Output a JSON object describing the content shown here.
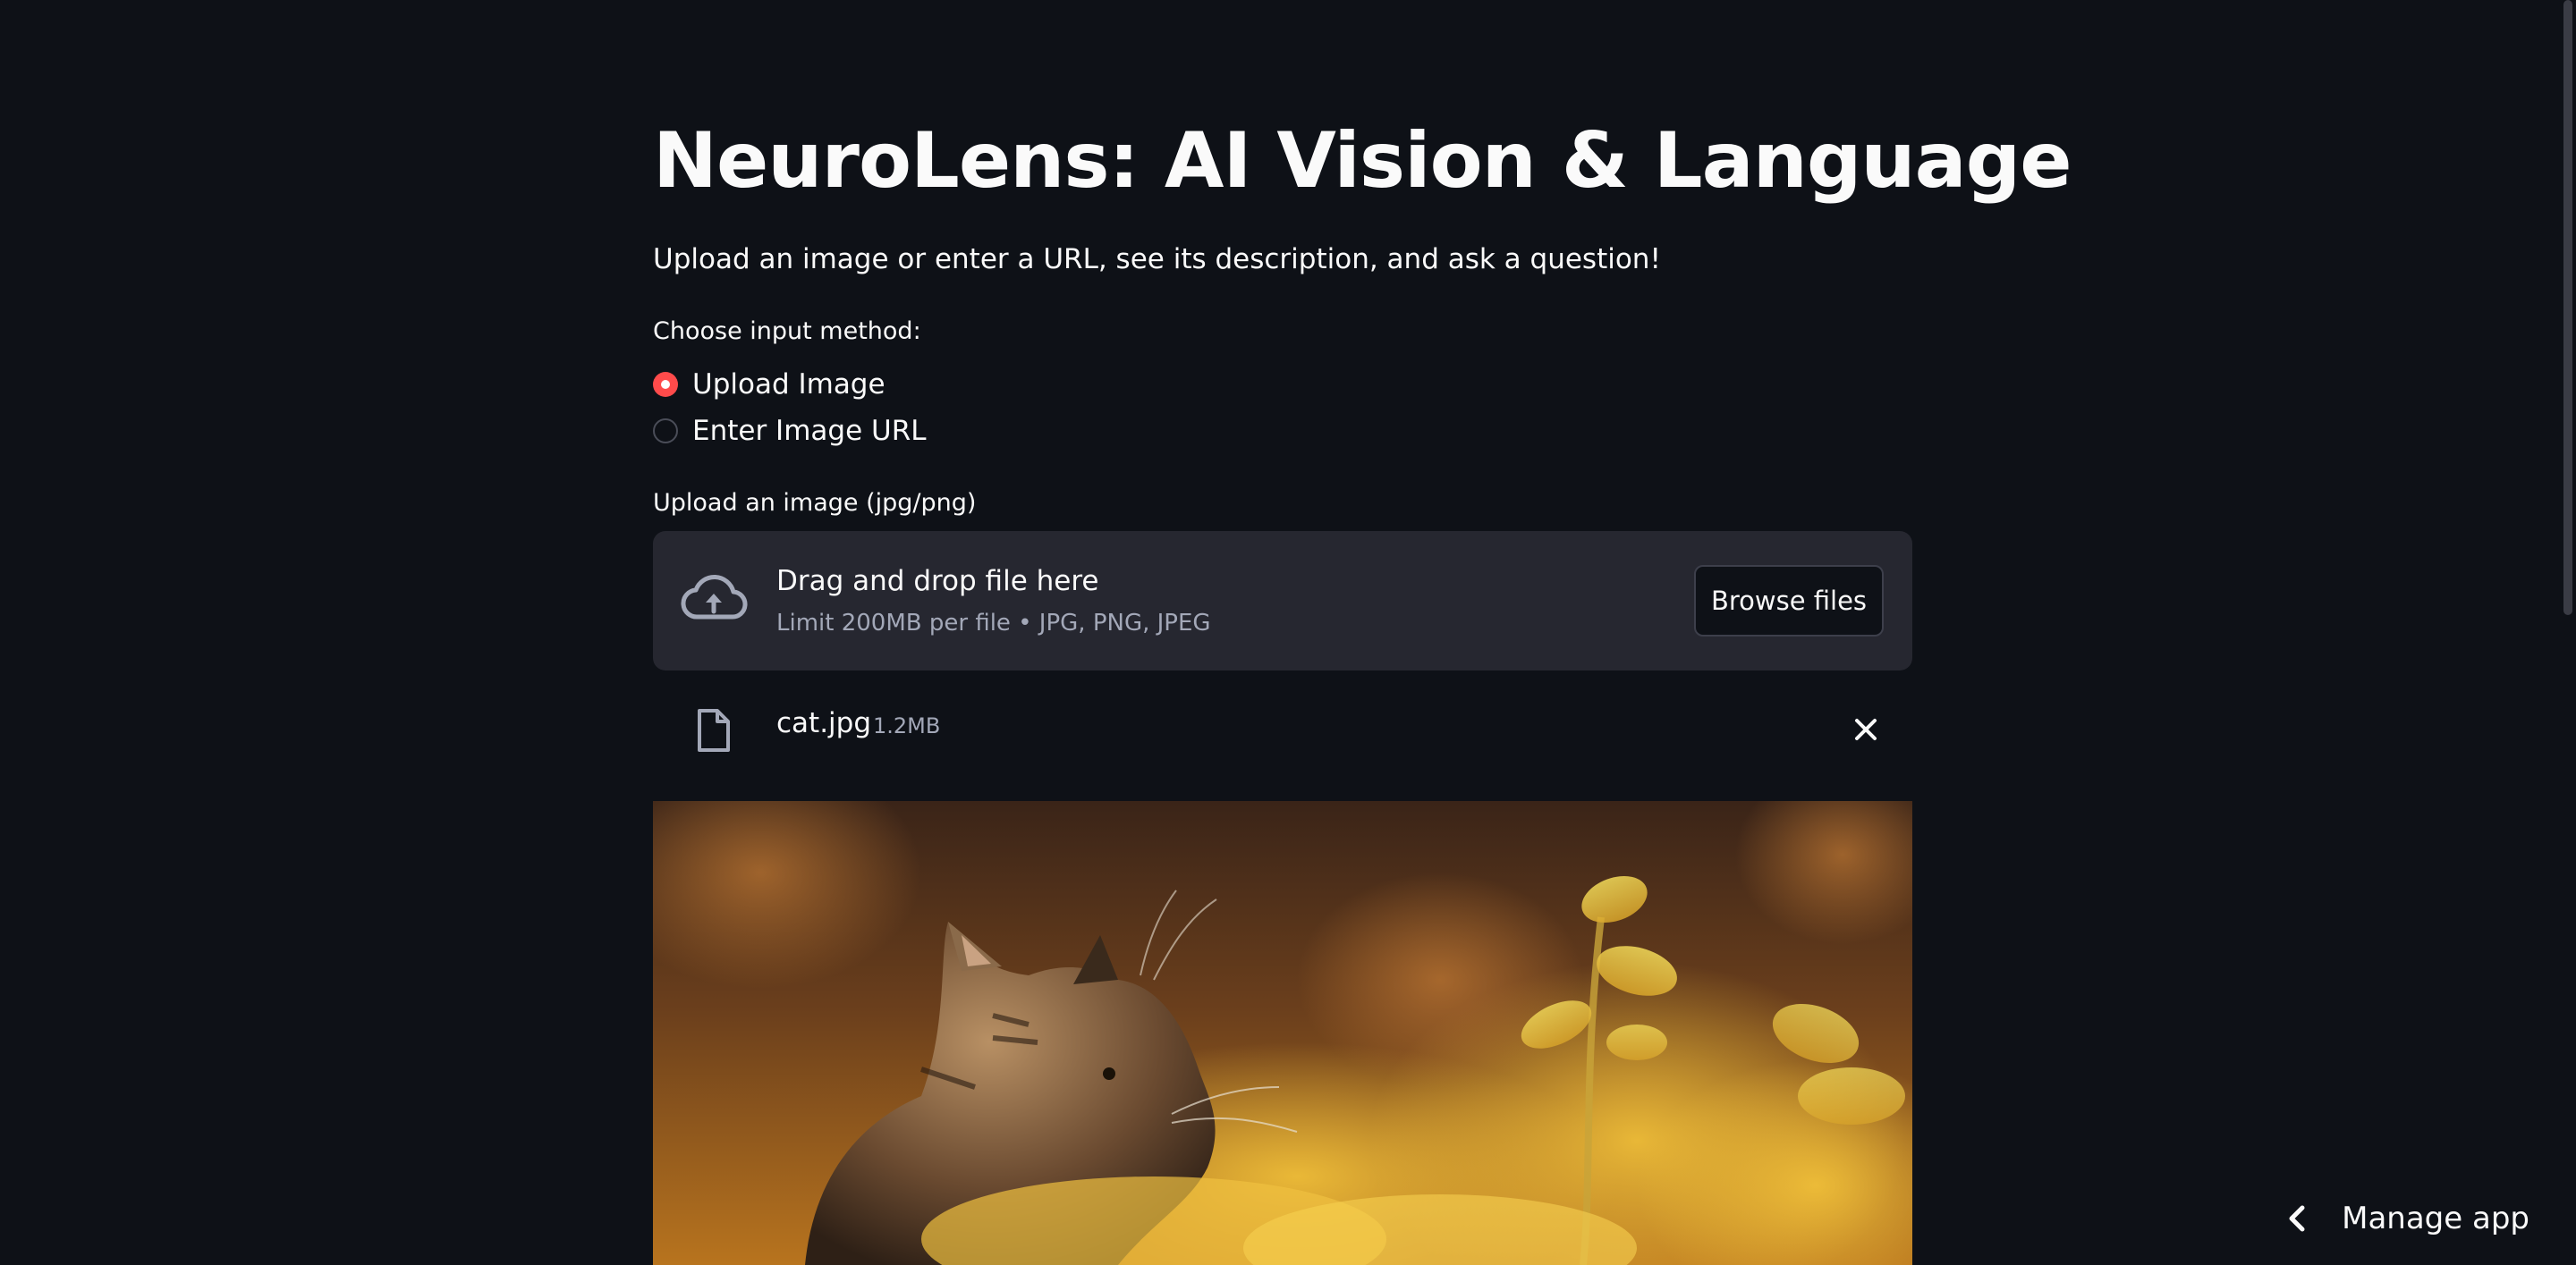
{
  "app": {
    "title": "NeuroLens: AI Vision & Language",
    "subtitle": "Upload an image or enter a URL, see its description, and ask a question!"
  },
  "input_method": {
    "label": "Choose input method:",
    "options": [
      {
        "label": "Upload Image",
        "selected": true
      },
      {
        "label": "Enter Image URL",
        "selected": false
      }
    ]
  },
  "uploader": {
    "label": "Upload an image (jpg/png)",
    "drop_title": "Drag and drop file here",
    "drop_limit": "Limit 200MB per file • JPG, PNG, JPEG",
    "browse_label": "Browse files",
    "icon": "cloud-upload-icon"
  },
  "uploaded_file": {
    "name": "cat.jpg",
    "size": "1.2MB",
    "icon": "file-icon",
    "remove_icon": "close-icon"
  },
  "preview_image": {
    "subject": "tabby kitten among yellow blurred leaves"
  },
  "manage_app": {
    "label": "Manage app",
    "icon": "chevron-left-icon"
  },
  "colors": {
    "background": "#0e1117",
    "surface": "#262730",
    "accent": "#ff4b4b",
    "text": "#fafafa",
    "muted_text": "#a3a8b8"
  }
}
